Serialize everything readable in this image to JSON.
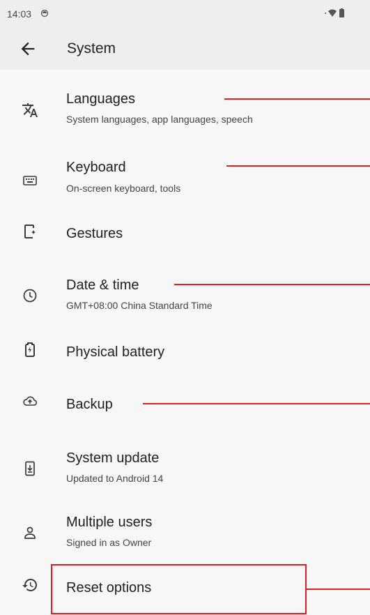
{
  "status_bar": {
    "time": "14:03",
    "left_icon": "sync-circle-icon",
    "right_icons": "wifi battery"
  },
  "app_bar": {
    "title": "System",
    "back_icon": "arrow-back-icon"
  },
  "items": [
    {
      "title": "Languages",
      "subtitle": "System languages, app languages, speech",
      "icon": "translate-icon"
    },
    {
      "title": "Keyboard",
      "subtitle": "On-screen keyboard, tools",
      "icon": "keyboard-icon"
    },
    {
      "title": "Gestures",
      "subtitle": "",
      "icon": "gestures-phone-icon"
    },
    {
      "title": "Date & time",
      "subtitle": "GMT+08:00 China Standard Time",
      "icon": "clock-icon"
    },
    {
      "title": "Physical battery",
      "subtitle": "",
      "icon": "battery-icon"
    },
    {
      "title": "Backup",
      "subtitle": "",
      "icon": "cloud-backup-icon"
    },
    {
      "title": "System update",
      "subtitle": "Updated to Android 14",
      "icon": "system-update-icon"
    },
    {
      "title": "Multiple users",
      "subtitle": "Signed in as Owner",
      "icon": "person-icon"
    },
    {
      "title": "Reset options",
      "subtitle": "",
      "icon": "history-icon"
    }
  ],
  "annotation_color": "#e02020"
}
